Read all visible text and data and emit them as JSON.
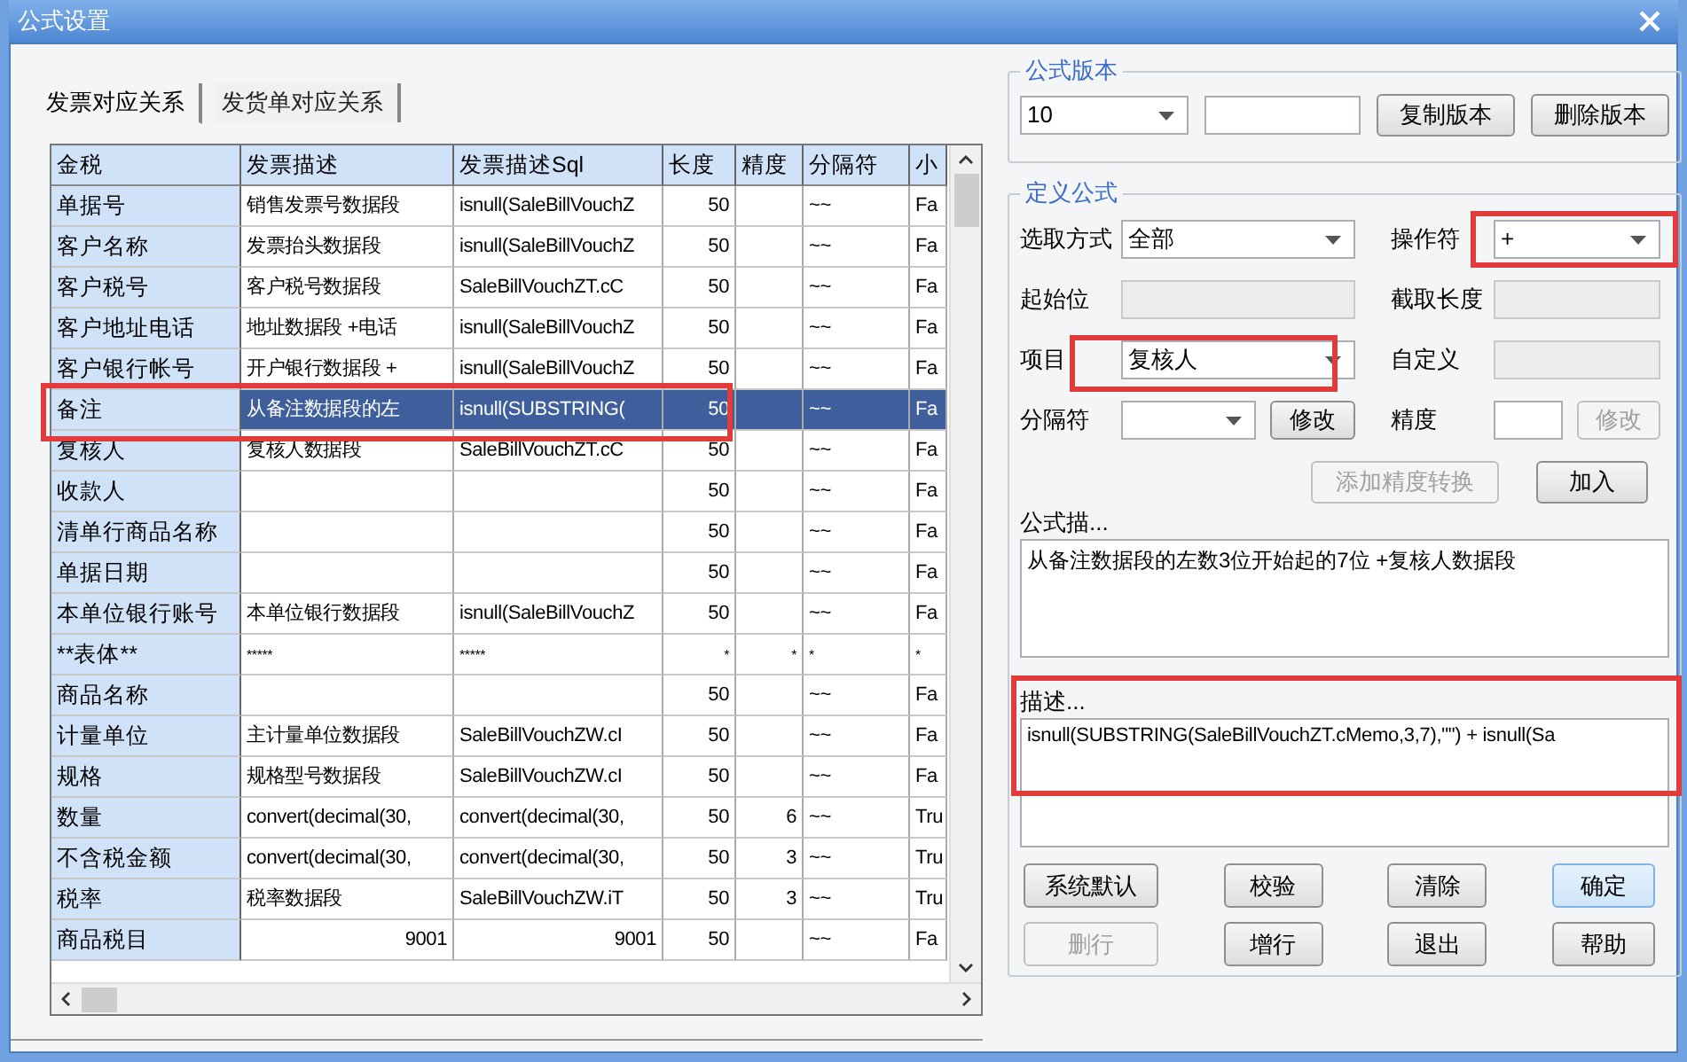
{
  "window": {
    "title": "公式设置"
  },
  "tabs": [
    {
      "label": "发票对应关系",
      "selected": true
    },
    {
      "label": "发货单对应关系",
      "selected": false
    }
  ],
  "table": {
    "columns": [
      "金税",
      "发票描述",
      "发票描述Sql",
      "长度",
      "精度",
      "分隔符",
      "小"
    ],
    "rows": [
      {
        "cells": [
          "单据号",
          "销售发票号数据段",
          "isnull(SaleBillVouchZ",
          "50",
          "",
          "~~",
          "Fa"
        ],
        "selected": false,
        "highlighted": false
      },
      {
        "cells": [
          "客户名称",
          "发票抬头数据段",
          "isnull(SaleBillVouchZ",
          "50",
          "",
          "~~",
          "Fa"
        ],
        "selected": false,
        "highlighted": false
      },
      {
        "cells": [
          "客户税号",
          "客户税号数据段",
          "SaleBillVouchZT.cC",
          "50",
          "",
          "~~",
          "Fa"
        ],
        "selected": false,
        "highlighted": false
      },
      {
        "cells": [
          "客户地址电话",
          "地址数据段 +电话",
          "isnull(SaleBillVouchZ",
          "50",
          "",
          "~~",
          "Fa"
        ],
        "selected": false,
        "highlighted": false
      },
      {
        "cells": [
          "客户银行帐号",
          "开户银行数据段 +",
          "isnull(SaleBillVouchZ",
          "50",
          "",
          "~~",
          "Fa"
        ],
        "selected": false,
        "highlighted": false
      },
      {
        "cells": [
          "备注",
          "从备注数据段的左",
          "isnull(SUBSTRING(",
          "50",
          "",
          "~~",
          "Fa"
        ],
        "selected": true,
        "highlighted": true
      },
      {
        "cells": [
          "复核人",
          "复核人数据段",
          "SaleBillVouchZT.cC",
          "50",
          "",
          "~~",
          "Fa"
        ],
        "selected": false,
        "highlighted": false
      },
      {
        "cells": [
          "收款人",
          "",
          "",
          "50",
          "",
          "~~",
          "Fa"
        ],
        "selected": false,
        "highlighted": false
      },
      {
        "cells": [
          "清单行商品名称",
          "",
          "",
          "50",
          "",
          "~~",
          "Fa"
        ],
        "selected": false,
        "highlighted": false
      },
      {
        "cells": [
          "单据日期",
          "",
          "",
          "50",
          "",
          "~~",
          "Fa"
        ],
        "selected": false,
        "highlighted": false
      },
      {
        "cells": [
          "本单位银行账号",
          "本单位银行数据段",
          "isnull(SaleBillVouchZ",
          "50",
          "",
          "~~",
          "Fa"
        ],
        "selected": false,
        "highlighted": false
      },
      {
        "cells": [
          "**表体**",
          "*****",
          "*****",
          "*",
          "*",
          "*",
          "*"
        ],
        "selected": false,
        "highlighted": false
      },
      {
        "cells": [
          "商品名称",
          "",
          "",
          "50",
          "",
          "~~",
          "Fa"
        ],
        "selected": false,
        "highlighted": false
      },
      {
        "cells": [
          "计量单位",
          "主计量单位数据段",
          "SaleBillVouchZW.cI",
          "50",
          "",
          "~~",
          "Fa"
        ],
        "selected": false,
        "highlighted": false
      },
      {
        "cells": [
          "规格",
          "规格型号数据段",
          "SaleBillVouchZW.cI",
          "50",
          "",
          "~~",
          "Fa"
        ],
        "selected": false,
        "highlighted": false
      },
      {
        "cells": [
          "数量",
          "convert(decimal(30,",
          "convert(decimal(30,",
          "50",
          "6",
          "~~",
          "Tru"
        ],
        "selected": false,
        "highlighted": false
      },
      {
        "cells": [
          "不含税金额",
          "convert(decimal(30,",
          "convert(decimal(30,",
          "50",
          "3",
          "~~",
          "Tru"
        ],
        "selected": false,
        "highlighted": false
      },
      {
        "cells": [
          "税率",
          "税率数据段",
          "SaleBillVouchZW.iT",
          "50",
          "3",
          "~~",
          "Tru"
        ],
        "selected": false,
        "highlighted": false
      },
      {
        "cells": [
          "商品税目",
          "9001",
          "9001",
          "50",
          "",
          "~~",
          "Fa"
        ],
        "selected": false,
        "highlighted": false
      }
    ]
  },
  "formula_version": {
    "title": "公式版本",
    "version": "10",
    "buttons": [
      {
        "label": "复制版本",
        "disabled": false
      },
      {
        "label": "删除版本",
        "disabled": false
      }
    ]
  },
  "define_formula": {
    "title": "定义公式",
    "selection_mode": {
      "label": "选取方式",
      "value": "全部"
    },
    "operator": {
      "label": "操作符",
      "value": "+",
      "highlighted": true
    },
    "start_position": {
      "label": "起始位",
      "disabled": true
    },
    "length": {
      "label": "截取长度",
      "disabled": true
    },
    "item": {
      "label": "项目",
      "value": "复核人",
      "highlighted": true
    },
    "custom": {
      "label": "自定义",
      "disabled": true
    },
    "separator": {
      "label": "分隔符",
      "button": {
        "label": "修改",
        "disabled": false
      }
    },
    "precision": {
      "label": "精度",
      "button": {
        "label": "修改",
        "disabled": true
      }
    },
    "add_precision_button": {
      "label": "添加精度转换",
      "disabled": true
    },
    "add_button": {
      "label": "加入",
      "disabled": false
    },
    "formula_description": {
      "label": "公式描...",
      "value": "从备注数据段的左数3位开始起的7位 +复核人数据段"
    },
    "sql_description": {
      "label": "描述...",
      "value": "isnull(SUBSTRING(SaleBillVouchZT.cMemo,3,7),\"\") + isnull(Sa",
      "highlighted": true
    },
    "buttons": [
      {
        "label": "系统默认",
        "disabled": false,
        "focused": false
      },
      {
        "label": "校验",
        "disabled": false,
        "focused": false
      },
      {
        "label": "清除",
        "disabled": false,
        "focused": false
      },
      {
        "label": "确定",
        "disabled": false,
        "focused": true
      },
      {
        "label": "删行",
        "disabled": true,
        "focused": false
      },
      {
        "label": "增行",
        "disabled": false,
        "focused": false
      },
      {
        "label": "退出",
        "disabled": false,
        "focused": false
      },
      {
        "label": "帮助",
        "disabled": false,
        "focused": false
      }
    ]
  }
}
